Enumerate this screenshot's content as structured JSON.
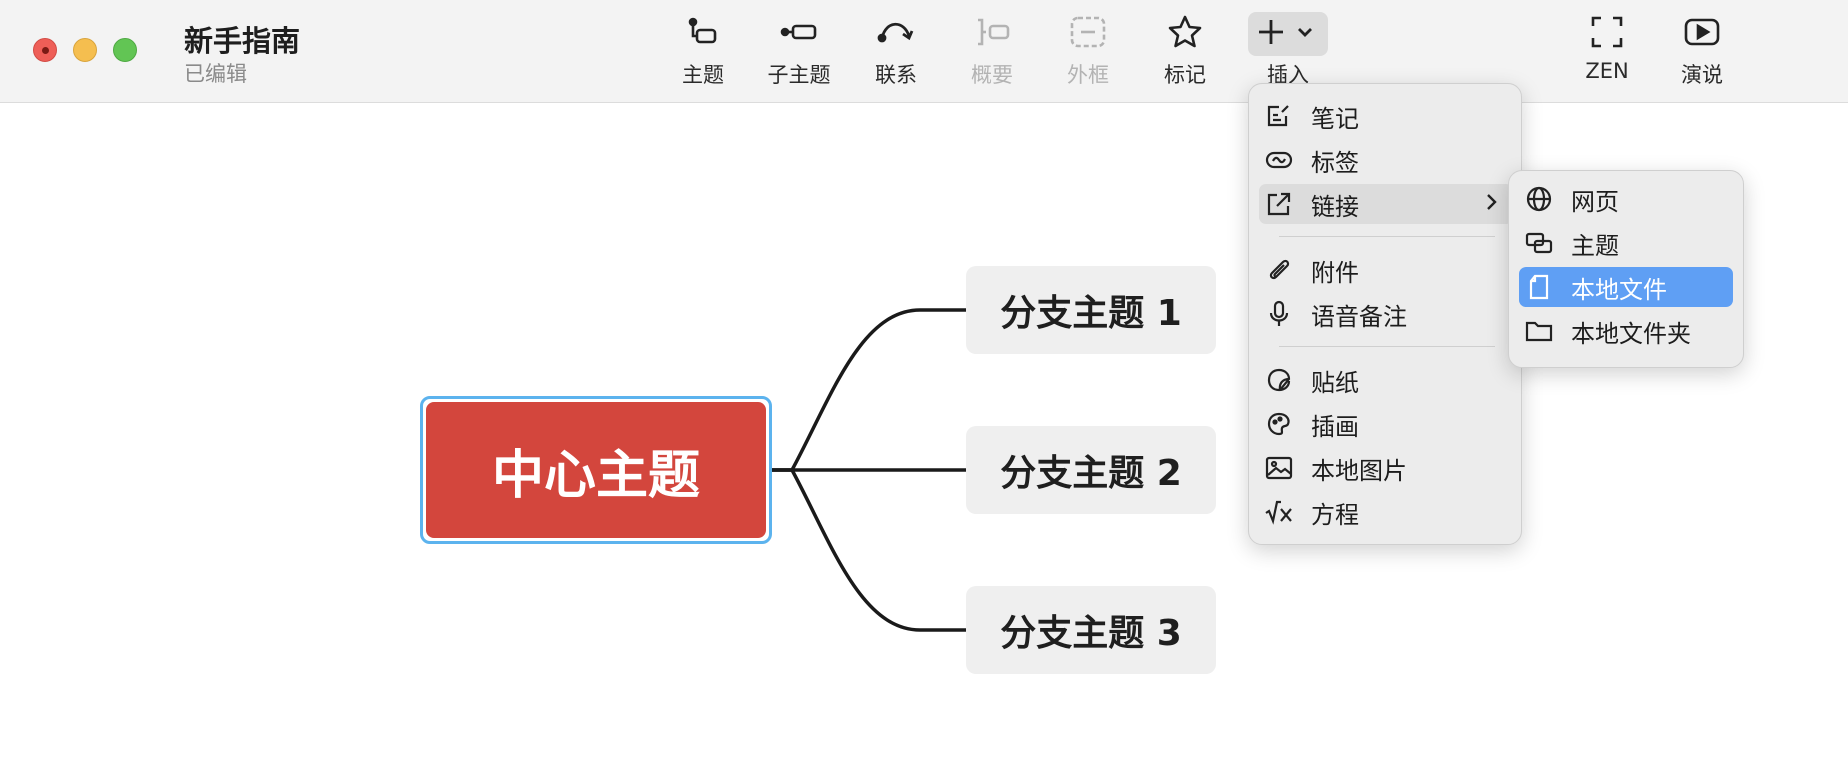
{
  "window": {
    "title": "新手指南",
    "subtitle": "已编辑"
  },
  "toolbar": {
    "topic": "主题",
    "subtopic": "子主题",
    "relationship": "联系",
    "summary": "概要",
    "boundary": "外框",
    "marker": "标记",
    "insert": "插入",
    "zen": "ZEN",
    "present": "演说"
  },
  "mindmap": {
    "central": "中心主题",
    "branches": [
      "分支主题 1",
      "分支主题 2",
      "分支主题 3"
    ],
    "colors": {
      "central": "#d3463d",
      "selection": "#5cb3ee",
      "branch": "#efefef"
    }
  },
  "insert_menu": {
    "items": [
      "笔记",
      "标签",
      "链接",
      "附件",
      "语音备注",
      "贴纸",
      "插画",
      "本地图片",
      "方程"
    ],
    "highlighted": "链接"
  },
  "link_submenu": {
    "items": [
      "网页",
      "主题",
      "本地文件",
      "本地文件夹"
    ],
    "selected": "本地文件",
    "accent": "#5f9ff4"
  }
}
